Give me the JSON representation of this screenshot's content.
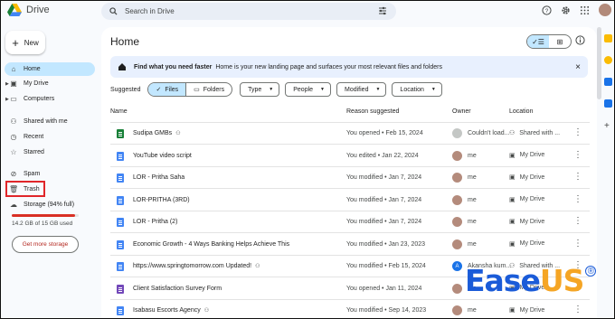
{
  "app": {
    "name": "Drive"
  },
  "search": {
    "placeholder": "Search in Drive"
  },
  "sidebar": {
    "new_label": "New",
    "items": [
      {
        "label": "Home",
        "icon": "home-icon",
        "active": true
      },
      {
        "label": "My Drive",
        "icon": "drive-icon"
      },
      {
        "label": "Computers",
        "icon": "computer-icon"
      },
      {
        "label": "Shared with me",
        "icon": "people-icon"
      },
      {
        "label": "Recent",
        "icon": "clock-icon"
      },
      {
        "label": "Starred",
        "icon": "star-icon"
      },
      {
        "label": "Spam",
        "icon": "spam-icon"
      },
      {
        "label": "Trash",
        "icon": "trash-icon"
      },
      {
        "label": "Storage (94% full)",
        "icon": "cloud-icon"
      }
    ],
    "storage_used_fraction": 0.94,
    "storage_text": "14.2 GB of 15 GB used",
    "get_storage_label": "Get more storage"
  },
  "main": {
    "title": "Home",
    "banner": {
      "bold": "Find what you need faster",
      "text": "Home is your new landing page and surfaces your most relevant files and folders"
    },
    "suggested_label": "Suggested",
    "segments": [
      "Files",
      "Folders"
    ],
    "filters": [
      "Type",
      "People",
      "Modified",
      "Location"
    ],
    "columns": {
      "name": "Name",
      "reason": "Reason suggested",
      "owner": "Owner",
      "location": "Location"
    },
    "rows": [
      {
        "name": "Sudipa GMBs",
        "shared": true,
        "reason": "You opened • Feb 15, 2024",
        "owner": "Couldn't load...",
        "location": "Shared with ...",
        "color": "#188038"
      },
      {
        "name": "YouTube video script",
        "shared": false,
        "reason": "You edited • Jan 22, 2024",
        "owner": "me",
        "location": "My Drive",
        "color": "#4285f4"
      },
      {
        "name": "LOR - Pritha Saha",
        "shared": false,
        "reason": "You modified • Jan 7, 2024",
        "owner": "me",
        "location": "My Drive",
        "color": "#4285f4"
      },
      {
        "name": "LOR-PRITHA (3RD)",
        "shared": false,
        "reason": "You modified • Jan 7, 2024",
        "owner": "me",
        "location": "My Drive",
        "color": "#4285f4"
      },
      {
        "name": "LOR - Pritha (2)",
        "shared": false,
        "reason": "You modified • Jan 7, 2024",
        "owner": "me",
        "location": "My Drive",
        "color": "#4285f4"
      },
      {
        "name": "Economic Growth - 4 Ways Banking Helps Achieve This",
        "shared": false,
        "reason": "You modified • Jan 23, 2023",
        "owner": "me",
        "location": "My Drive",
        "color": "#4285f4"
      },
      {
        "name": "https://www.springtomorrow.com Updated!",
        "shared": true,
        "reason": "You modified • Feb 15, 2024",
        "owner": "Akansha kum...",
        "location": "Shared with ...",
        "color": "#4285f4"
      },
      {
        "name": "Client Satisfaction Survey Form",
        "shared": false,
        "reason": "You opened • Jan 11, 2024",
        "owner": "me",
        "location": "My Drive",
        "color": "#7248b9"
      },
      {
        "name": "Isabasu Escorts Agency",
        "shared": true,
        "reason": "You modified • Sep 14, 2023",
        "owner": "me",
        "location": "My Drive",
        "color": "#4285f4"
      }
    ]
  },
  "watermark": {
    "text_a": "Ease",
    "text_b": "US",
    "mark": "®"
  }
}
